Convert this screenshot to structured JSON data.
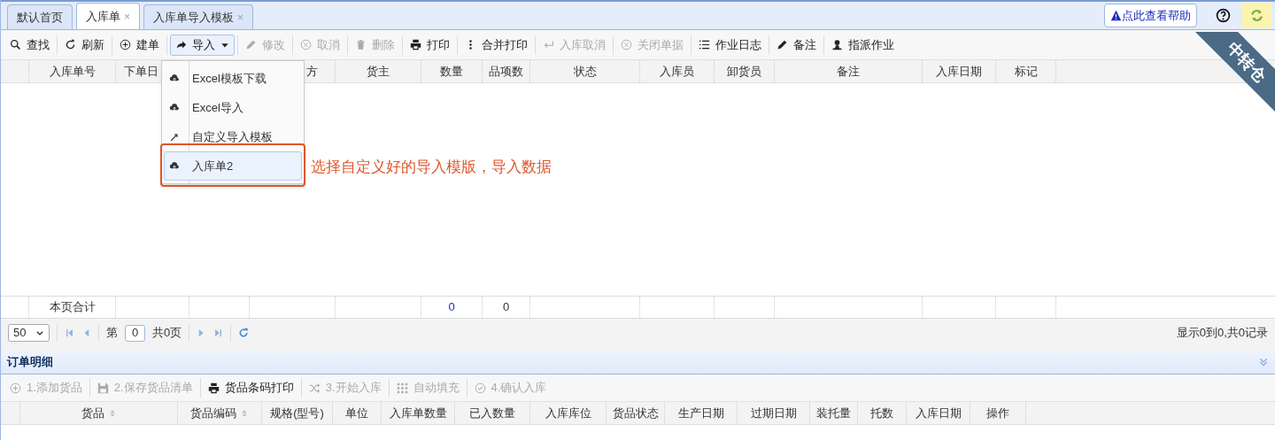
{
  "tabs": [
    {
      "label": "默认首页",
      "selected": false
    },
    {
      "label": "入库单",
      "close": "×",
      "selected": true
    },
    {
      "label": "入库单导入模板",
      "close": "×",
      "selected": false
    }
  ],
  "help": {
    "tooltip": "点此查看帮助"
  },
  "ribbon": "中转仓",
  "toolbar": [
    {
      "label": "查找",
      "disabled": false
    },
    {
      "label": "刷新",
      "disabled": false
    },
    {
      "label": "建单",
      "disabled": false
    },
    {
      "label": "导入",
      "disabled": false,
      "expanded": true
    },
    {
      "label": "修改",
      "disabled": true
    },
    {
      "label": "取消",
      "disabled": true
    },
    {
      "label": "删除",
      "disabled": true
    },
    {
      "label": "打印",
      "disabled": false
    },
    {
      "label": "合并打印",
      "disabled": false
    },
    {
      "label": "入库取消",
      "disabled": true
    },
    {
      "label": "关闭单据",
      "disabled": true
    },
    {
      "label": "作业日志",
      "disabled": false
    },
    {
      "label": "备注",
      "disabled": false
    },
    {
      "label": "指派作业",
      "disabled": false
    }
  ],
  "import_menu": [
    {
      "label": "Excel模板下载",
      "selected": false
    },
    {
      "label": "Excel导入",
      "selected": false
    },
    {
      "label": "自定义导入模板",
      "selected": false
    },
    {
      "label": "入库单2",
      "selected": true
    }
  ],
  "annotation": "选择自定义好的导入模版，导入数据",
  "table": {
    "columns": [
      "入库单号",
      "下单日",
      "方",
      "货主",
      "数量",
      "品项数",
      "状态",
      "入库员",
      "卸货员",
      "备注",
      "入库日期",
      "标记"
    ],
    "totals": {
      "label": "本页合计",
      "quantity": "0",
      "item_count": "0"
    }
  },
  "pager": {
    "page_size": "50",
    "page_prefix": "第",
    "page": "0",
    "page_suffix": "共0页",
    "summary": "显示0到0,共0记录"
  },
  "detail": {
    "title": "订单明细",
    "toolbar": [
      {
        "label": "1.添加货品",
        "disabled": true
      },
      {
        "label": "2.保存货品清单",
        "disabled": true
      },
      {
        "label": "货品条码打印",
        "disabled": false
      },
      {
        "label": "3.开始入库",
        "disabled": true
      },
      {
        "label": "自动填充",
        "disabled": true
      },
      {
        "label": "4.确认入库",
        "disabled": true
      }
    ],
    "columns": [
      {
        "label": "货品",
        "sortable": true
      },
      {
        "label": "货品编码",
        "sortable": true
      },
      {
        "label": "规格(型号)",
        "sortable": false
      },
      {
        "label": "单位",
        "sortable": false
      },
      {
        "label": "入库单数量",
        "sortable": false
      },
      {
        "label": "已入数量",
        "sortable": false
      },
      {
        "label": "入库库位",
        "sortable": false
      },
      {
        "label": "货品状态",
        "sortable": false
      },
      {
        "label": "生产日期",
        "sortable": false
      },
      {
        "label": "过期日期",
        "sortable": false
      },
      {
        "label": "装托量",
        "sortable": false
      },
      {
        "label": "托数",
        "sortable": false
      },
      {
        "label": "入库日期",
        "sortable": false
      },
      {
        "label": "操作",
        "sortable": false
      }
    ]
  }
}
